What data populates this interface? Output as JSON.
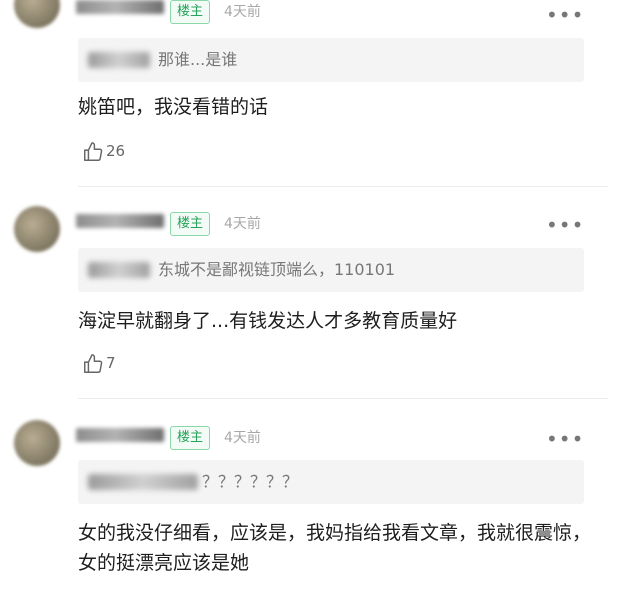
{
  "comments": [
    {
      "badge": "楼主",
      "time": "4天前",
      "more": "•••",
      "quote": "那谁...是谁",
      "text": "姚笛吧，我没看错的话",
      "likes": "26"
    },
    {
      "badge": "楼主",
      "time": "4天前",
      "more": "•••",
      "quote": "东城不是鄙视链顶端么，110101",
      "text": "海淀早就翻身了...有钱发达人才多教育质量好",
      "likes": "7"
    },
    {
      "badge": "楼主",
      "time": "4天前",
      "more": "•••",
      "quote": "？？？？？？",
      "text": "女的我没仔细看，应该是，我妈指给我看文章，我就很震惊，女的挺漂亮应该是她",
      "likes": ""
    }
  ]
}
